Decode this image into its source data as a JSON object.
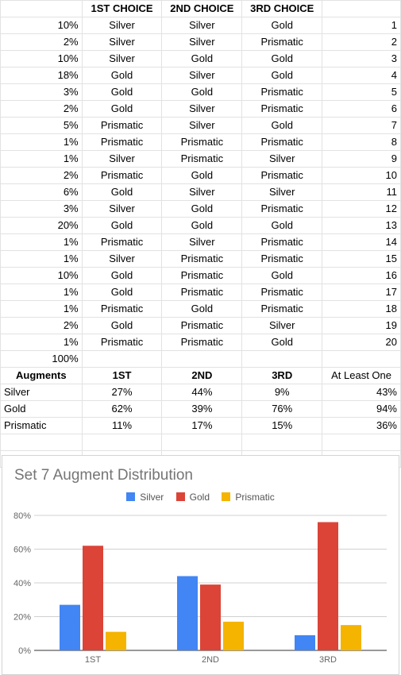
{
  "headers": [
    "",
    "1ST CHOICE",
    "2ND CHOICE",
    "3RD CHOICE",
    ""
  ],
  "rows": [
    {
      "pct": "10%",
      "c1": "Silver",
      "c2": "Silver",
      "c3": "Gold",
      "n": "1"
    },
    {
      "pct": "2%",
      "c1": "Silver",
      "c2": "Silver",
      "c3": "Prismatic",
      "n": "2"
    },
    {
      "pct": "10%",
      "c1": "Silver",
      "c2": "Gold",
      "c3": "Gold",
      "n": "3"
    },
    {
      "pct": "18%",
      "c1": "Gold",
      "c2": "Silver",
      "c3": "Gold",
      "n": "4"
    },
    {
      "pct": "3%",
      "c1": "Gold",
      "c2": "Gold",
      "c3": "Prismatic",
      "n": "5"
    },
    {
      "pct": "2%",
      "c1": "Gold",
      "c2": "Silver",
      "c3": "Prismatic",
      "n": "6"
    },
    {
      "pct": "5%",
      "c1": "Prismatic",
      "c2": "Silver",
      "c3": "Gold",
      "n": "7"
    },
    {
      "pct": "1%",
      "c1": "Prismatic",
      "c2": "Prismatic",
      "c3": "Prismatic",
      "n": "8"
    },
    {
      "pct": "1%",
      "c1": "Silver",
      "c2": "Prismatic",
      "c3": "Silver",
      "n": "9"
    },
    {
      "pct": "2%",
      "c1": "Prismatic",
      "c2": "Gold",
      "c3": "Prismatic",
      "n": "10"
    },
    {
      "pct": "6%",
      "c1": "Gold",
      "c2": "Silver",
      "c3": "Silver",
      "n": "11"
    },
    {
      "pct": "3%",
      "c1": "Silver",
      "c2": "Gold",
      "c3": "Prismatic",
      "n": "12"
    },
    {
      "pct": "20%",
      "c1": "Gold",
      "c2": "Gold",
      "c3": "Gold",
      "n": "13"
    },
    {
      "pct": "1%",
      "c1": "Prismatic",
      "c2": "Silver",
      "c3": "Prismatic",
      "n": "14"
    },
    {
      "pct": "1%",
      "c1": "Silver",
      "c2": "Prismatic",
      "c3": "Prismatic",
      "n": "15"
    },
    {
      "pct": "10%",
      "c1": "Gold",
      "c2": "Prismatic",
      "c3": "Gold",
      "n": "16"
    },
    {
      "pct": "1%",
      "c1": "Gold",
      "c2": "Prismatic",
      "c3": "Prismatic",
      "n": "17"
    },
    {
      "pct": "1%",
      "c1": "Prismatic",
      "c2": "Gold",
      "c3": "Prismatic",
      "n": "18"
    },
    {
      "pct": "2%",
      "c1": "Gold",
      "c2": "Prismatic",
      "c3": "Silver",
      "n": "19"
    },
    {
      "pct": "1%",
      "c1": "Prismatic",
      "c2": "Prismatic",
      "c3": "Gold",
      "n": "20"
    }
  ],
  "total": "100%",
  "summary": {
    "headers": [
      "Augments",
      "1ST",
      "2ND",
      "3RD",
      "At Least One"
    ],
    "rows": [
      {
        "name": "Silver",
        "v1": "27%",
        "v2": "44%",
        "v3": "9%",
        "any": "43%"
      },
      {
        "name": "Gold",
        "v1": "62%",
        "v2": "39%",
        "v3": "76%",
        "any": "94%"
      },
      {
        "name": "Prismatic",
        "v1": "11%",
        "v2": "17%",
        "v3": "15%",
        "any": "36%"
      }
    ]
  },
  "chart_data": {
    "type": "bar",
    "title": "Set 7 Augment Distribution",
    "categories": [
      "1ST",
      "2ND",
      "3RD"
    ],
    "series": [
      {
        "name": "Silver",
        "values": [
          27,
          44,
          9
        ],
        "color": "#4285f4"
      },
      {
        "name": "Gold",
        "values": [
          62,
          39,
          76
        ],
        "color": "#db4437"
      },
      {
        "name": "Prismatic",
        "values": [
          11,
          17,
          15
        ],
        "color": "#f4b400"
      }
    ],
    "ylim": [
      0,
      80
    ],
    "yticks": [
      "0%",
      "20%",
      "40%",
      "60%",
      "80%"
    ],
    "legend": "top",
    "grid": true
  }
}
